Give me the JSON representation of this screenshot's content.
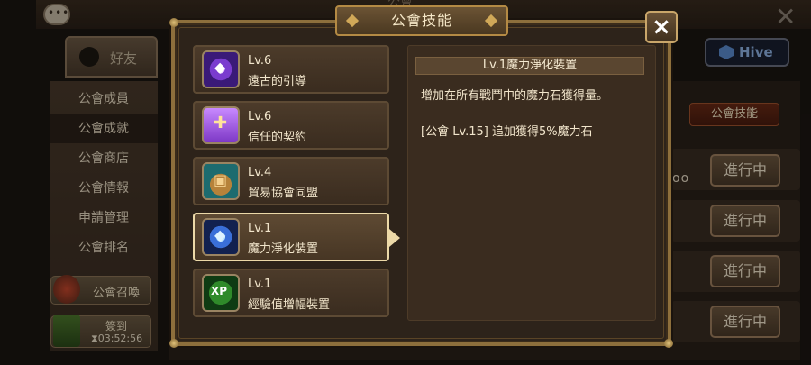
{
  "background": {
    "title_stub": "公會",
    "friend_tab": "好友",
    "hive_label": "Hive",
    "sidebar": [
      "公會成員",
      "公會成就",
      "公會商店",
      "公會情報",
      "申請管理",
      "公會排名"
    ],
    "summon_label": "公會召喚",
    "checkin_label": "簽到",
    "checkin_timer": "03:52:56",
    "guild_skill_btn": "公會技能",
    "status_buttons": [
      "進行中",
      "進行中",
      "進行中",
      "進行中"
    ],
    "dots": "oo"
  },
  "modal": {
    "title": "公會技能",
    "close_label": "×",
    "skills": [
      {
        "level": "Lv.6",
        "name": "遠古的引導",
        "icon": "ancient-guidance-icon"
      },
      {
        "level": "Lv.6",
        "name": "信任的契約",
        "icon": "contract-icon"
      },
      {
        "level": "Lv.4",
        "name": "貿易協會同盟",
        "icon": "trade-alliance-icon"
      },
      {
        "level": "Lv.1",
        "name": "魔力淨化裝置",
        "icon": "mana-purifier-icon"
      },
      {
        "level": "Lv.1",
        "name": "經驗值增幅裝置",
        "icon": "xp-booster-icon"
      }
    ],
    "detail": {
      "heading": "Lv.1魔力淨化裝置",
      "description": "增加在所有戰鬥中的魔力石獲得量。",
      "bonus": "[公會 Lv.15] 追加獲得5%魔力石"
    }
  }
}
